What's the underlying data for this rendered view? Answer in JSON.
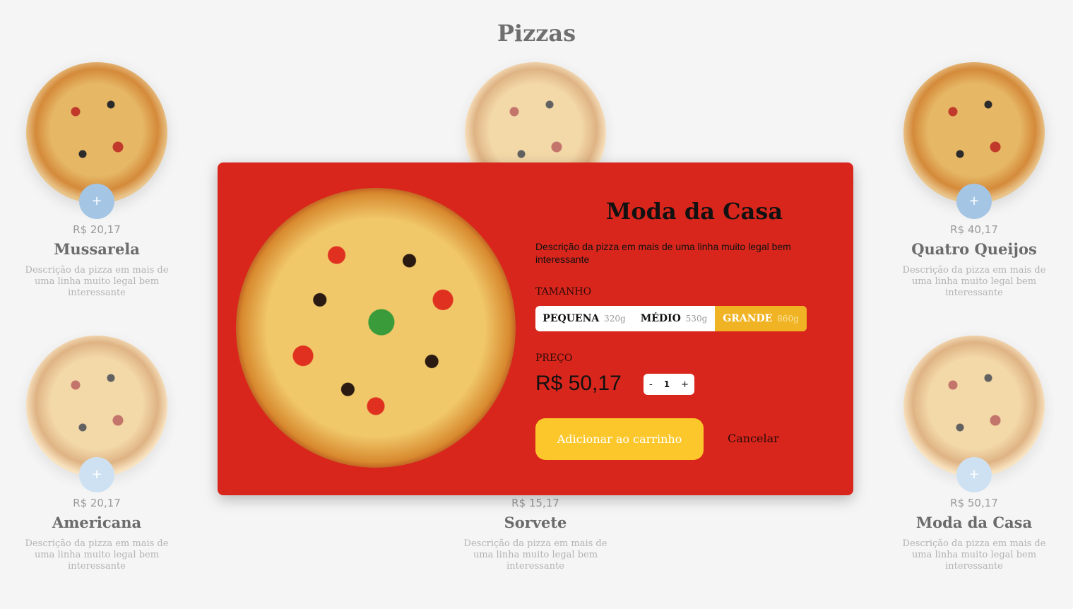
{
  "page": {
    "title": "Pizzas"
  },
  "pizzas": [
    {
      "price": "R$ 20,17",
      "name": "Mussarela",
      "desc": "Descrição da pizza em mais de uma linha muito legal bem interessante",
      "add": "+"
    },
    {
      "price": "",
      "name": "",
      "desc": "",
      "add": ""
    },
    {
      "price": "R$ 40,17",
      "name": "Quatro Queijos",
      "desc": "Descrição da pizza em mais de uma linha muito legal bem interessante",
      "add": "+"
    },
    {
      "price": "R$ 20,17",
      "name": "Americana",
      "desc": "Descrição da pizza em mais de uma linha muito legal bem interessante",
      "add": "+"
    },
    {
      "price": "R$ 15,17",
      "name": "Sorvete",
      "desc": "Descrição da pizza em mais de uma linha muito legal bem interessante",
      "add": ""
    },
    {
      "price": "R$ 50,17",
      "name": "Moda da Casa",
      "desc": "Descrição da pizza em mais de uma linha muito legal bem interessante",
      "add": "+"
    }
  ],
  "modal": {
    "title": "Moda da Casa",
    "desc": "Descrição da pizza em mais de uma linha muito legal bem interessante",
    "size_label": "TAMANHO",
    "sizes": [
      {
        "label": "PEQUENA",
        "weight": "320g"
      },
      {
        "label": "MÉDIO",
        "weight": "530g"
      },
      {
        "label": "GRANDE",
        "weight": "860g"
      }
    ],
    "selected_size": "GRANDE",
    "price_label": "PREÇO",
    "price": "R$ 50,17",
    "qty_minus": "-",
    "qty_value": "1",
    "qty_plus": "+",
    "add_to_cart": "Adicionar ao carrinho",
    "cancel": "Cancelar"
  },
  "colors": {
    "modal_bg": "#d9261c",
    "selected_size": "#f0b323",
    "cart_button": "#fcc72b",
    "add_button": "#a4c5e4",
    "page_bg": "#f5f5f5"
  }
}
